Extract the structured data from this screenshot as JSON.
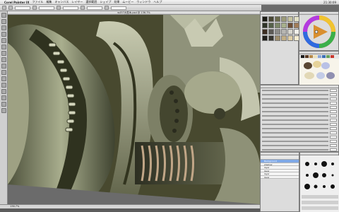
{
  "menubar": {
    "app_name": "Corel Painter IX",
    "items": [
      "ファイル",
      "編集",
      "キャンバス",
      "レイヤー",
      "選択範囲",
      "シェイプ",
      "効果",
      "ムービー",
      "ウィンドウ",
      "ヘルプ"
    ],
    "clock": "21:30:09"
  },
  "document": {
    "title": "w457大型木.psd @ 136.7%"
  },
  "statusbar": {
    "zoom": "136.7%"
  },
  "layers": {
    "rows": [
      "Background",
      "shadow",
      "layer",
      "layer",
      "layer",
      "layer"
    ],
    "selected_index": 0
  },
  "colors": {
    "canvas_bg": "#58583e",
    "accent": "#7fa8e6"
  }
}
